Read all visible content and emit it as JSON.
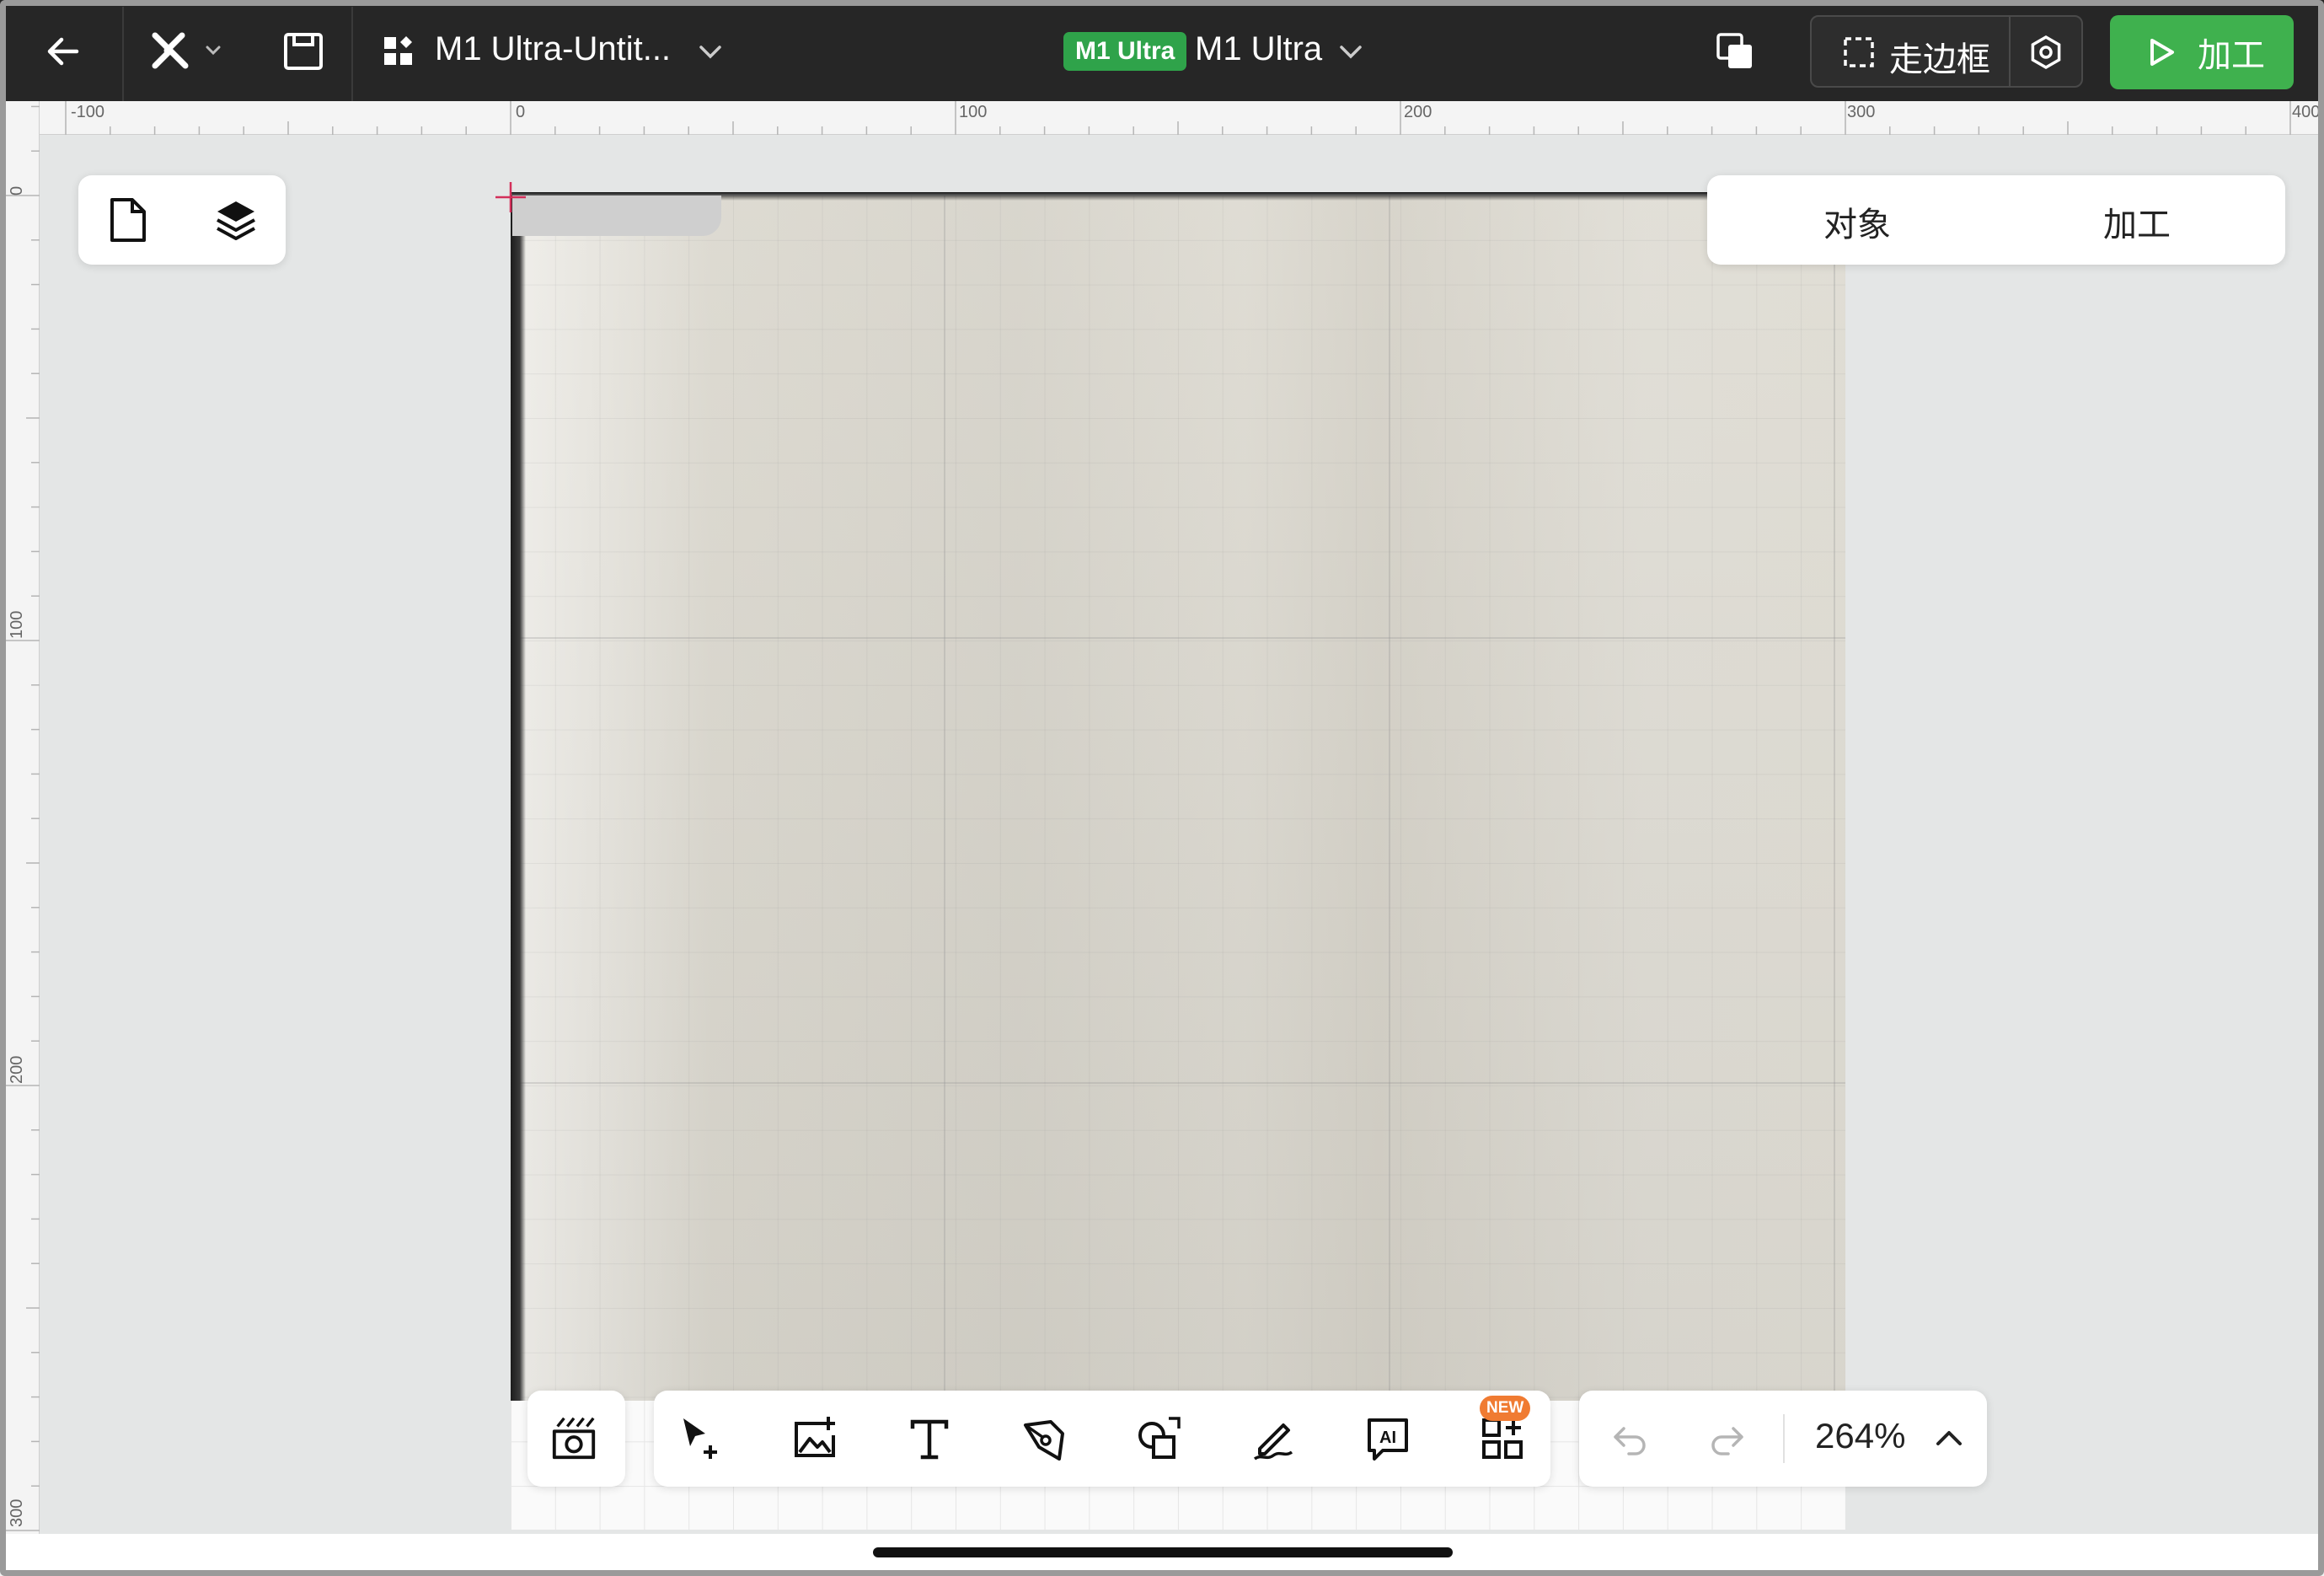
{
  "topbar": {
    "project_title": "M1 Ultra-Untit...",
    "device_badge": "M1 Ultra",
    "device_name": "M1 Ultra",
    "frame_label": "走边框",
    "process_label": "加工"
  },
  "rulers": {
    "top": [
      "-100",
      "0",
      "100",
      "200",
      "300",
      "400"
    ],
    "left": [
      "0",
      "100",
      "200",
      "300"
    ]
  },
  "right_panel": {
    "tabs": [
      "对象",
      "加工"
    ]
  },
  "toolbar": {
    "tools": [
      {
        "name": "select-add",
        "icon": "cursor-plus-icon"
      },
      {
        "name": "add-image",
        "icon": "image-plus-icon"
      },
      {
        "name": "text",
        "icon": "text-icon"
      },
      {
        "name": "pen",
        "icon": "pen-icon"
      },
      {
        "name": "shapes",
        "icon": "shapes-icon"
      },
      {
        "name": "draw",
        "icon": "pencil-icon"
      },
      {
        "name": "ai-text",
        "icon": "ai-text-icon"
      },
      {
        "name": "more",
        "icon": "grid-plus-icon"
      }
    ],
    "new_badge": "NEW"
  },
  "zoom": {
    "level": "264%"
  },
  "colors": {
    "topbar": "#262626",
    "accent_green": "#3fb14e",
    "badge_green": "#2fa34a",
    "new_orange": "#f07b32",
    "origin_marker": "#d32f5a"
  }
}
